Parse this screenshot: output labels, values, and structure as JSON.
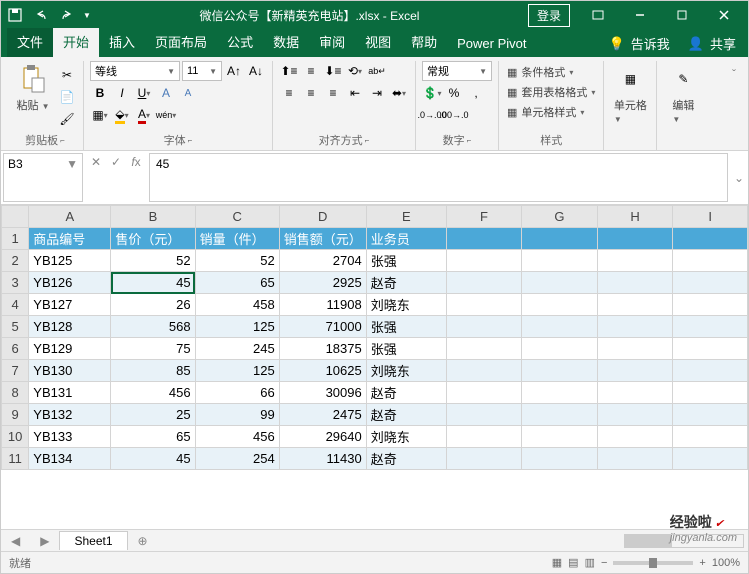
{
  "title": "微信公众号【新精英充电站】.xlsx - Excel",
  "login": "登录",
  "menu": {
    "file": "文件",
    "home": "开始",
    "insert": "插入",
    "layout": "页面布局",
    "formula": "公式",
    "data": "数据",
    "review": "审阅",
    "view": "视图",
    "help": "帮助",
    "pivot": "Power Pivot",
    "tell": "告诉我",
    "share": "共享"
  },
  "ribbon": {
    "clipboard": {
      "paste": "粘贴",
      "label": "剪贴板"
    },
    "font": {
      "name": "等线",
      "size": "11",
      "label": "字体"
    },
    "align": {
      "label": "对齐方式"
    },
    "number": {
      "format": "常规",
      "label": "数字"
    },
    "styles": {
      "cond": "条件格式",
      "table": "套用表格格式",
      "cell": "单元格样式",
      "label": "样式"
    },
    "cells": {
      "btn": "单元格"
    },
    "edit": {
      "btn": "编辑"
    }
  },
  "namebox": "B3",
  "formula": "45",
  "cols": [
    "A",
    "B",
    "C",
    "D",
    "E",
    "F",
    "G",
    "H",
    "I"
  ],
  "headers": [
    "商品编号",
    "售价（元）",
    "销量（件）",
    "销售额（元）",
    "业务员"
  ],
  "rows": [
    {
      "n": 2,
      "c": [
        "YB125",
        "52",
        "52",
        "2704",
        "张强"
      ],
      "s": false
    },
    {
      "n": 3,
      "c": [
        "YB126",
        "45",
        "65",
        "2925",
        "赵奇"
      ],
      "s": true
    },
    {
      "n": 4,
      "c": [
        "YB127",
        "26",
        "458",
        "11908",
        "刘晓东"
      ],
      "s": false
    },
    {
      "n": 5,
      "c": [
        "YB128",
        "568",
        "125",
        "71000",
        "张强"
      ],
      "s": true
    },
    {
      "n": 6,
      "c": [
        "YB129",
        "75",
        "245",
        "18375",
        "张强"
      ],
      "s": false
    },
    {
      "n": 7,
      "c": [
        "YB130",
        "85",
        "125",
        "10625",
        "刘晓东"
      ],
      "s": true
    },
    {
      "n": 8,
      "c": [
        "YB131",
        "456",
        "66",
        "30096",
        "赵奇"
      ],
      "s": false
    },
    {
      "n": 9,
      "c": [
        "YB132",
        "25",
        "99",
        "2475",
        "赵奇"
      ],
      "s": true
    },
    {
      "n": 10,
      "c": [
        "YB133",
        "65",
        "456",
        "29640",
        "刘晓东"
      ],
      "s": false
    },
    {
      "n": 11,
      "c": [
        "YB134",
        "45",
        "254",
        "11430",
        "赵奇"
      ],
      "s": true
    }
  ],
  "sheet": "Sheet1",
  "status": "就绪",
  "zoom": "100%",
  "watermark": {
    "brand": "经验啦",
    "url": "jingyanla.com"
  }
}
